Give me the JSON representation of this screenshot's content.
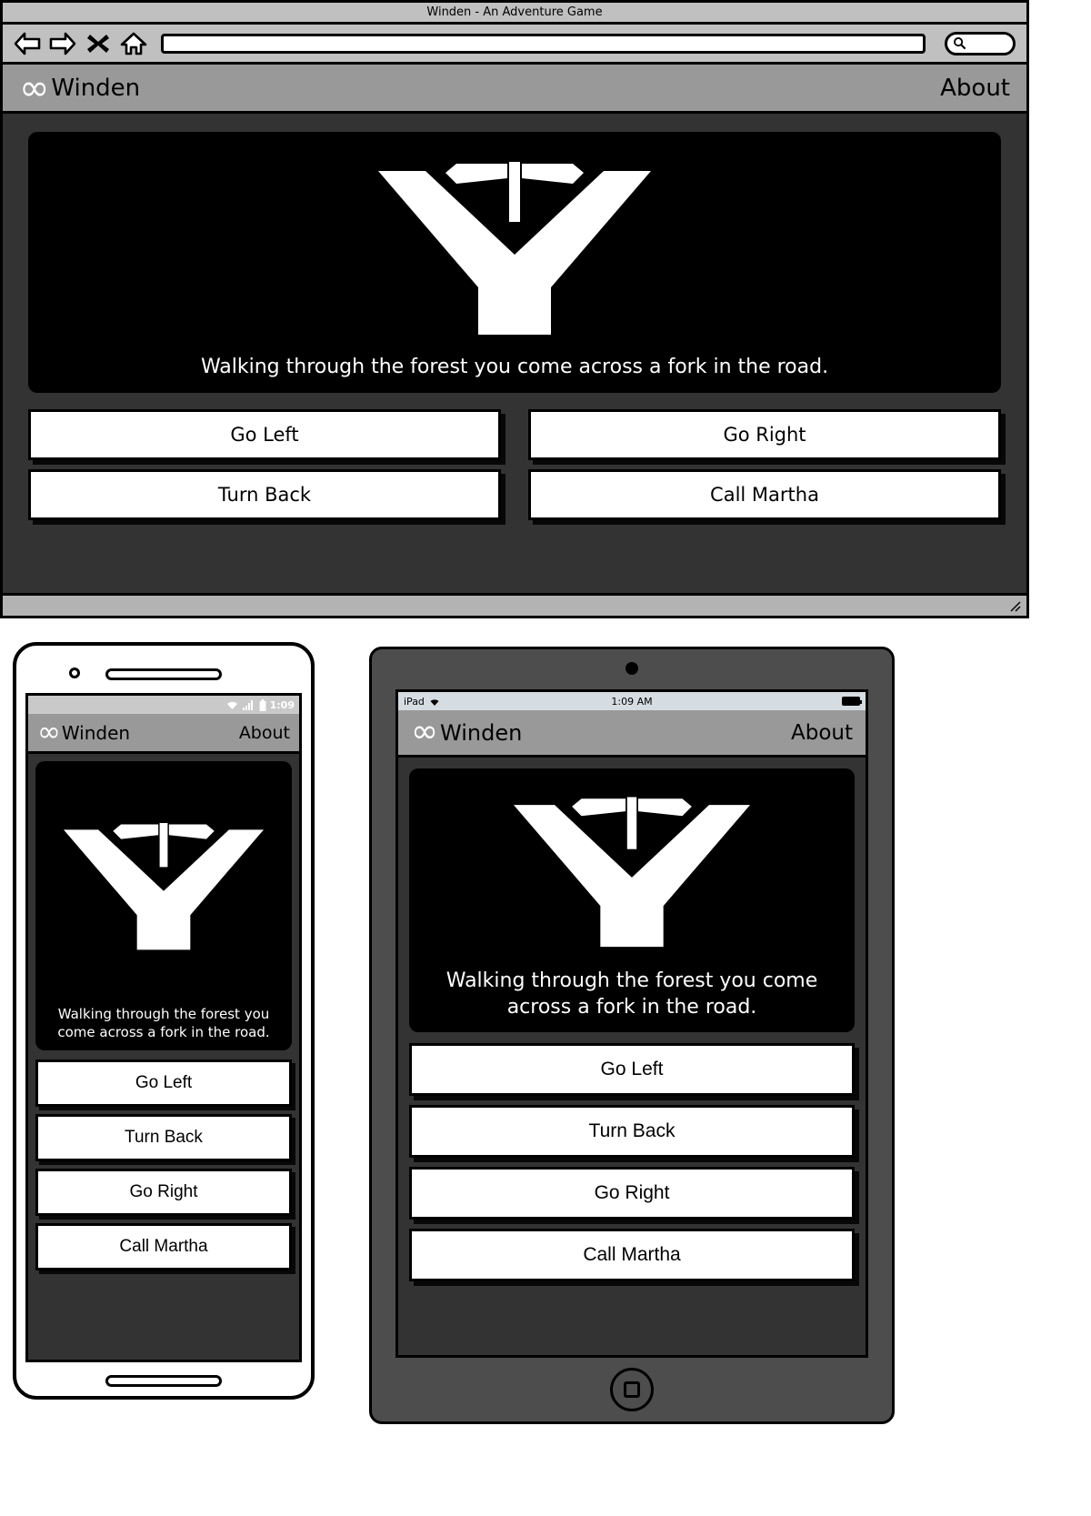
{
  "browser": {
    "window_title": "Winden - An Adventure Game",
    "url_value": "",
    "url_placeholder": "",
    "search_value": "",
    "search_placeholder": "",
    "nav": {
      "back_label": "Back",
      "forward_label": "Forward",
      "stop_label": "Stop",
      "home_label": "Home"
    }
  },
  "app": {
    "brand_logo": "infinity-logo",
    "brand_name": "Winden",
    "about_label": "About",
    "scene": {
      "art": "fork-in-the-road-signpost",
      "caption": "Walking through the forest you come across a fork in the road."
    },
    "desktop_choices": [
      {
        "label": "Go Left"
      },
      {
        "label": "Go Right"
      },
      {
        "label": "Turn Back"
      },
      {
        "label": "Call Martha"
      }
    ],
    "mobile_choices": [
      {
        "label": "Go Left"
      },
      {
        "label": "Turn Back"
      },
      {
        "label": "Go Right"
      },
      {
        "label": "Call Martha"
      }
    ]
  },
  "phone": {
    "status_time": "1:09",
    "wifi_icon": "wifi-icon",
    "signal_icon": "signal-bars-icon",
    "battery_icon": "battery-icon"
  },
  "tablet": {
    "status_device": "iPad",
    "status_time": "1:09 AM",
    "wifi_icon": "wifi-icon",
    "battery_icon": "battery-icon"
  },
  "colors": {
    "chrome_gray": "#c0c0c0",
    "header_gray": "#999999",
    "stage_dark": "#333333",
    "card_black": "#000000",
    "button_white": "#ffffff",
    "tablet_body": "#4d4d4d"
  }
}
